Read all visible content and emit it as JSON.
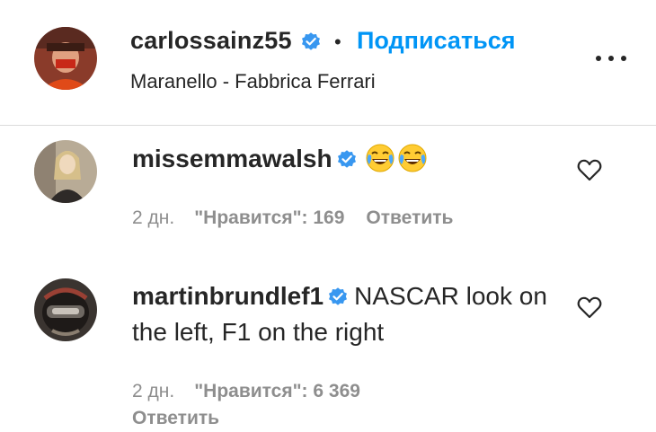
{
  "post": {
    "username": "carlossainz55",
    "separator": "•",
    "follow_label": "Подписаться",
    "location": "Maranello - Fabbrica Ferrari"
  },
  "comments": [
    {
      "username": "missemmawalsh",
      "text": "",
      "emojis": [
        "face-with-tears-of-joy-emoji",
        "face-with-tears-of-joy-emoji"
      ],
      "time": "2 дн.",
      "likes": "\"Нравится\": 169",
      "reply": "Ответить"
    },
    {
      "username": "martinbrundlef1",
      "text": "NASCAR look on the left, F1 on the right",
      "time": "2 дн.",
      "likes": "\"Нравится\": 6 369",
      "reply": "Ответить"
    }
  ],
  "colors": {
    "accent": "#0095f6",
    "text": "#262626",
    "muted": "#8e8e8e",
    "divider": "#dbdbdb"
  },
  "icons": [
    "verified-icon",
    "more-options-icon",
    "heart-icon"
  ]
}
